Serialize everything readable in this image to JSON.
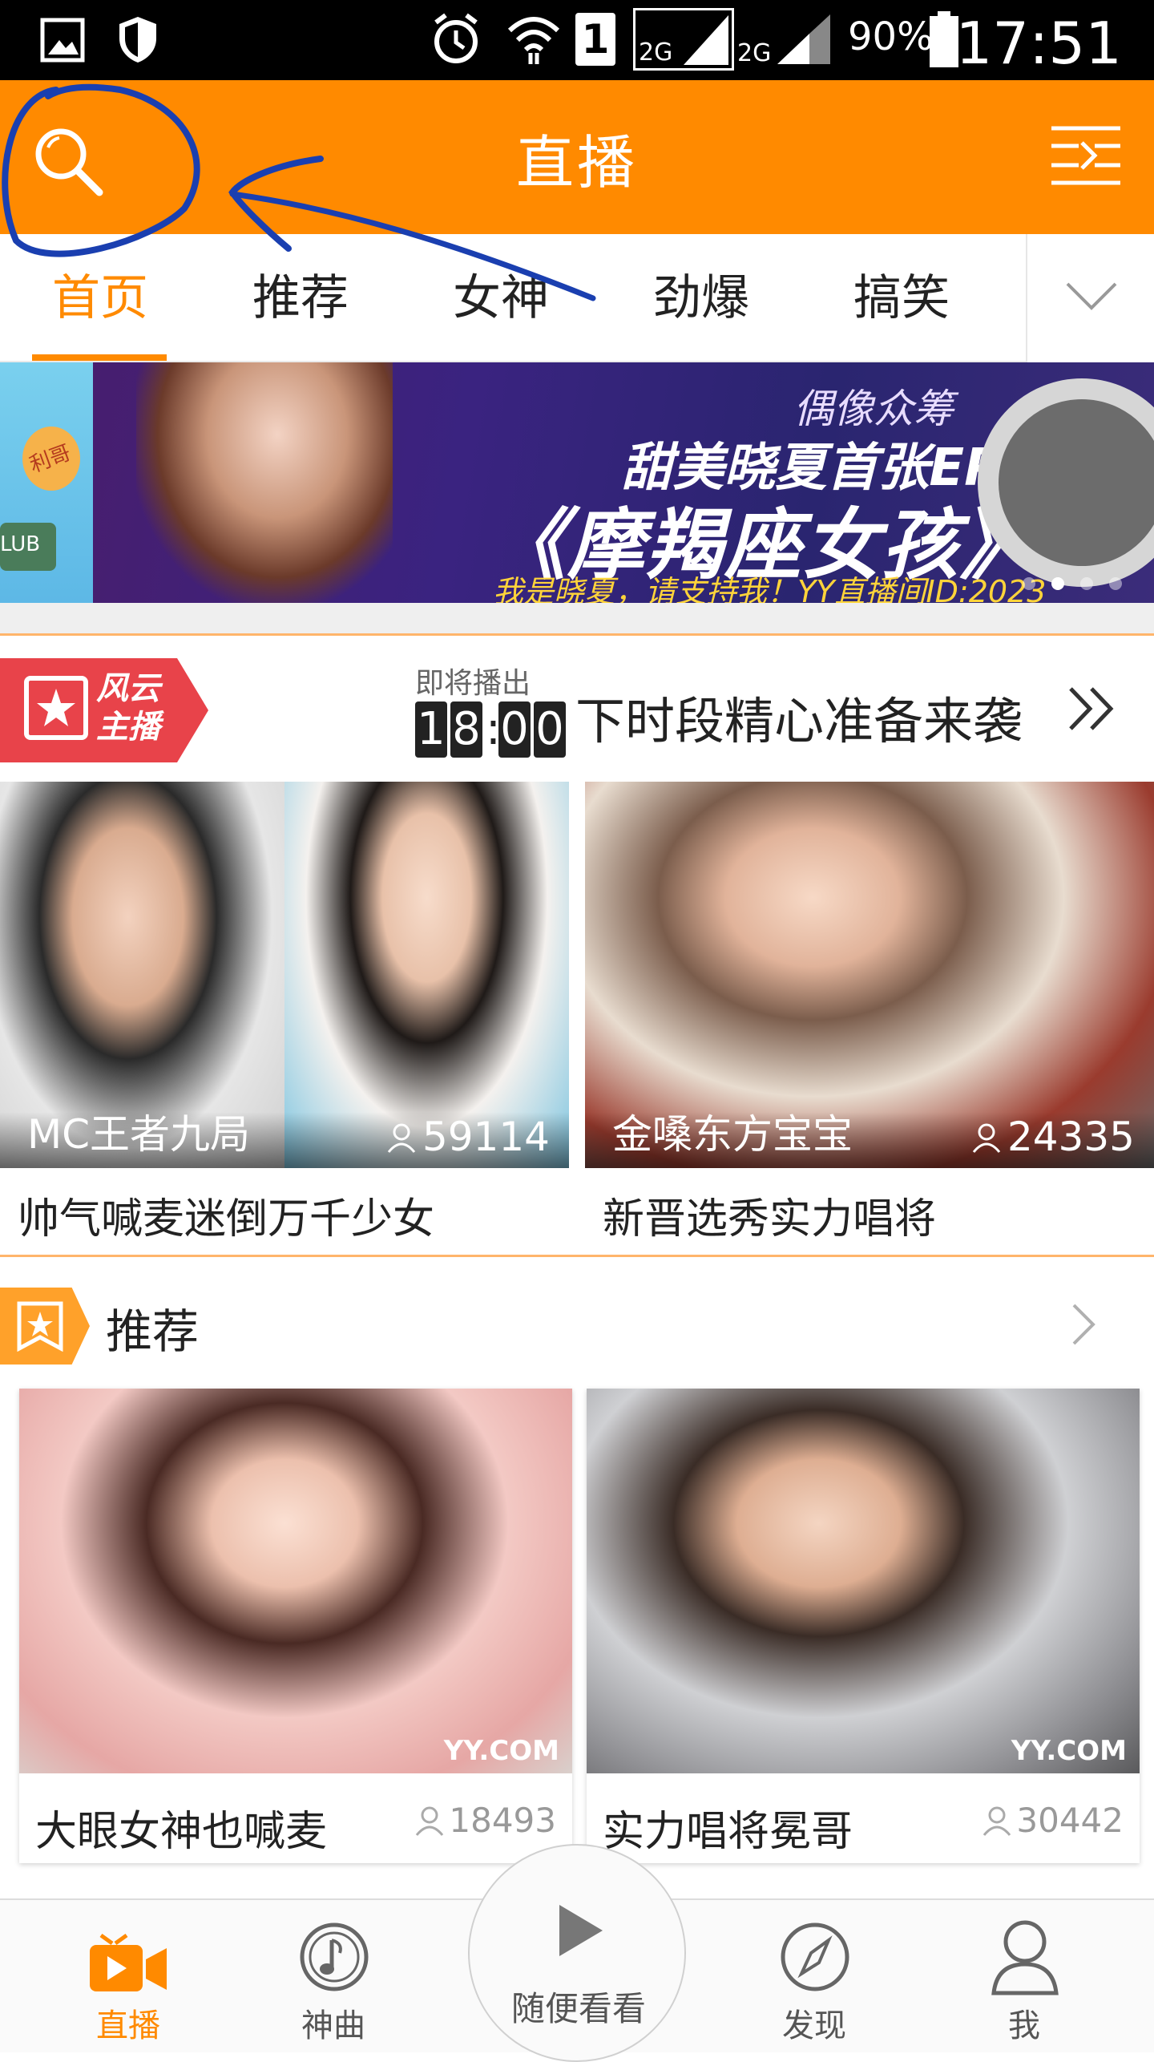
{
  "status_bar": {
    "sim_label": "1",
    "network_1": "2G",
    "network_2": "2G",
    "battery": "90%",
    "time": "17:51"
  },
  "header": {
    "title": "直播",
    "search_icon": "search-icon",
    "menu_icon": "list-icon"
  },
  "tabs": [
    {
      "label": "首页",
      "active": true
    },
    {
      "label": "推荐"
    },
    {
      "label": "女神"
    },
    {
      "label": "劲爆"
    },
    {
      "label": "搞笑"
    }
  ],
  "banner": {
    "brand": "偶像众筹",
    "subtitle": "甜美晓夏首张EP",
    "main": "《摩羯座女孩》",
    "caption": "我是晓夏，请支持我！YY直播间ID:2023",
    "side_tag": "利哥",
    "side_text": "LUB",
    "page_count": 4,
    "active_page": 2
  },
  "featured": {
    "badge": "风云\n主播",
    "soon_label": "即将播出",
    "time_digits": [
      "1",
      "8",
      "0",
      "0"
    ],
    "headline": "下时段精心准备来袭",
    "more_icon": "double-chevron-right-icon",
    "cards": [
      {
        "host": "MC王者九局",
        "viewers": "59114",
        "title": "帅气喊麦迷倒万千少女"
      },
      {
        "host": "金嗓东方宝宝",
        "viewers": "24335",
        "title": "新晋选秀实力唱将"
      }
    ]
  },
  "recommend": {
    "title": "推荐",
    "cards": [
      {
        "title": "大眼女神也喊麦",
        "viewers": "18493",
        "watermark": "YY.COM"
      },
      {
        "title": "实力唱将冕哥",
        "viewers": "30442",
        "watermark": "YY.COM"
      }
    ]
  },
  "bottom_nav": {
    "items": [
      {
        "label": "直播",
        "icon": "video-camera-icon",
        "active": true
      },
      {
        "label": "神曲",
        "icon": "music-note-icon"
      },
      {
        "label": "发现",
        "icon": "compass-icon"
      },
      {
        "label": "我",
        "icon": "user-icon"
      }
    ],
    "center": {
      "label": "随便看看",
      "icon": "play-icon"
    }
  },
  "colors": {
    "brand_orange": "#ff8a00",
    "badge_red": "#e8434a",
    "annotation_blue": "#1a3fb0"
  }
}
